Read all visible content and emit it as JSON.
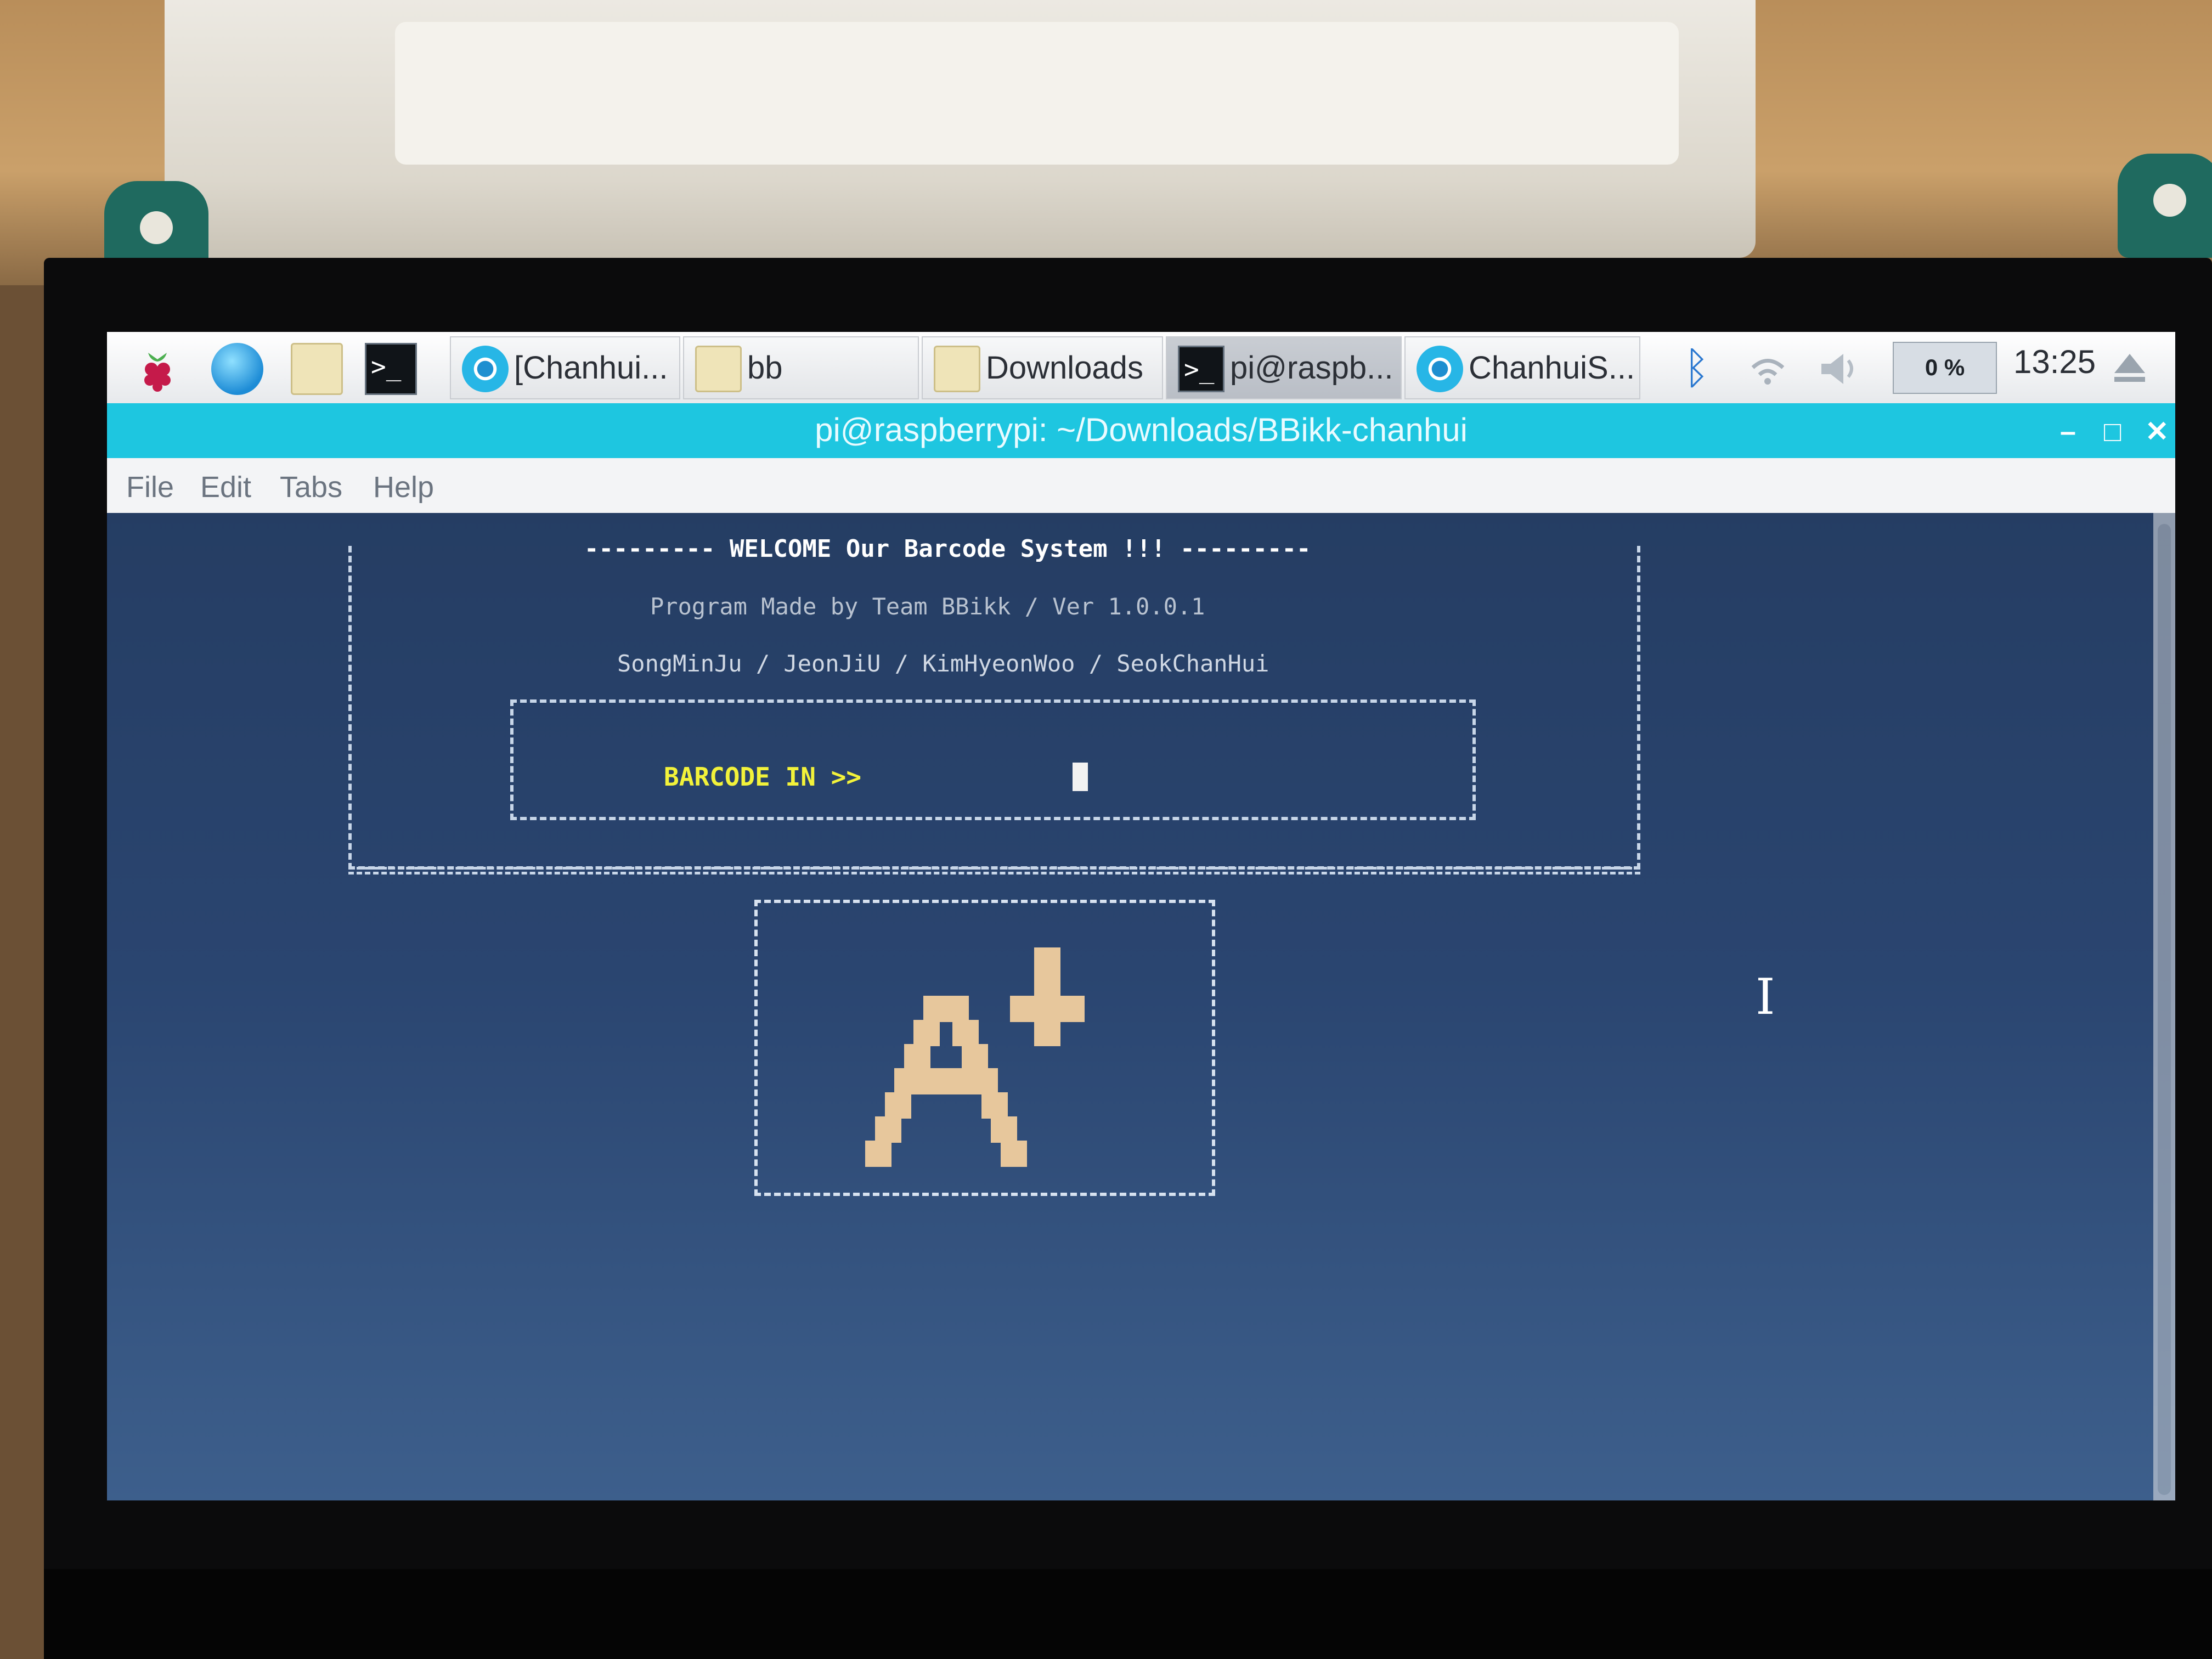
{
  "taskbar": {
    "launchers": [
      "raspberry-menu-icon",
      "web-browser-icon",
      "file-manager-icon",
      "terminal-icon"
    ],
    "window_buttons": [
      {
        "label": "[Chanhui...",
        "icon": "chromium-icon",
        "active": false
      },
      {
        "label": "bb",
        "icon": "folder-icon",
        "active": false
      },
      {
        "label": "Downloads",
        "icon": "folder-icon",
        "active": false
      },
      {
        "label": "pi@raspb...",
        "icon": "terminal-icon",
        "active": true
      },
      {
        "label": "ChanhuiS...",
        "icon": "chromium-icon",
        "active": false
      }
    ],
    "cpu_usage": "0 %",
    "clock": "13:25"
  },
  "window": {
    "title": "pi@raspberrypi: ~/Downloads/BBikk-chanhui",
    "controls": [
      "–",
      "□",
      "✕"
    ]
  },
  "menu": [
    "File",
    "Edit",
    "Tabs",
    "Help"
  ],
  "terminal": {
    "welcome": "--------- WELCOME Our Barcode System !!! ---------",
    "made_by": "Program Made by   Team BBikk / Ver 1.0.0.1",
    "members": "SongMinJu / JeonJiU / KimHyeonWoo / SeokChanHui",
    "barcode_prompt": "BARCODE IN >>",
    "logo_text": "A+"
  },
  "colors": {
    "titlebar": "#1ec6e0",
    "prompt_yellow": "#f2f23a",
    "logo": "#e7c79c"
  }
}
